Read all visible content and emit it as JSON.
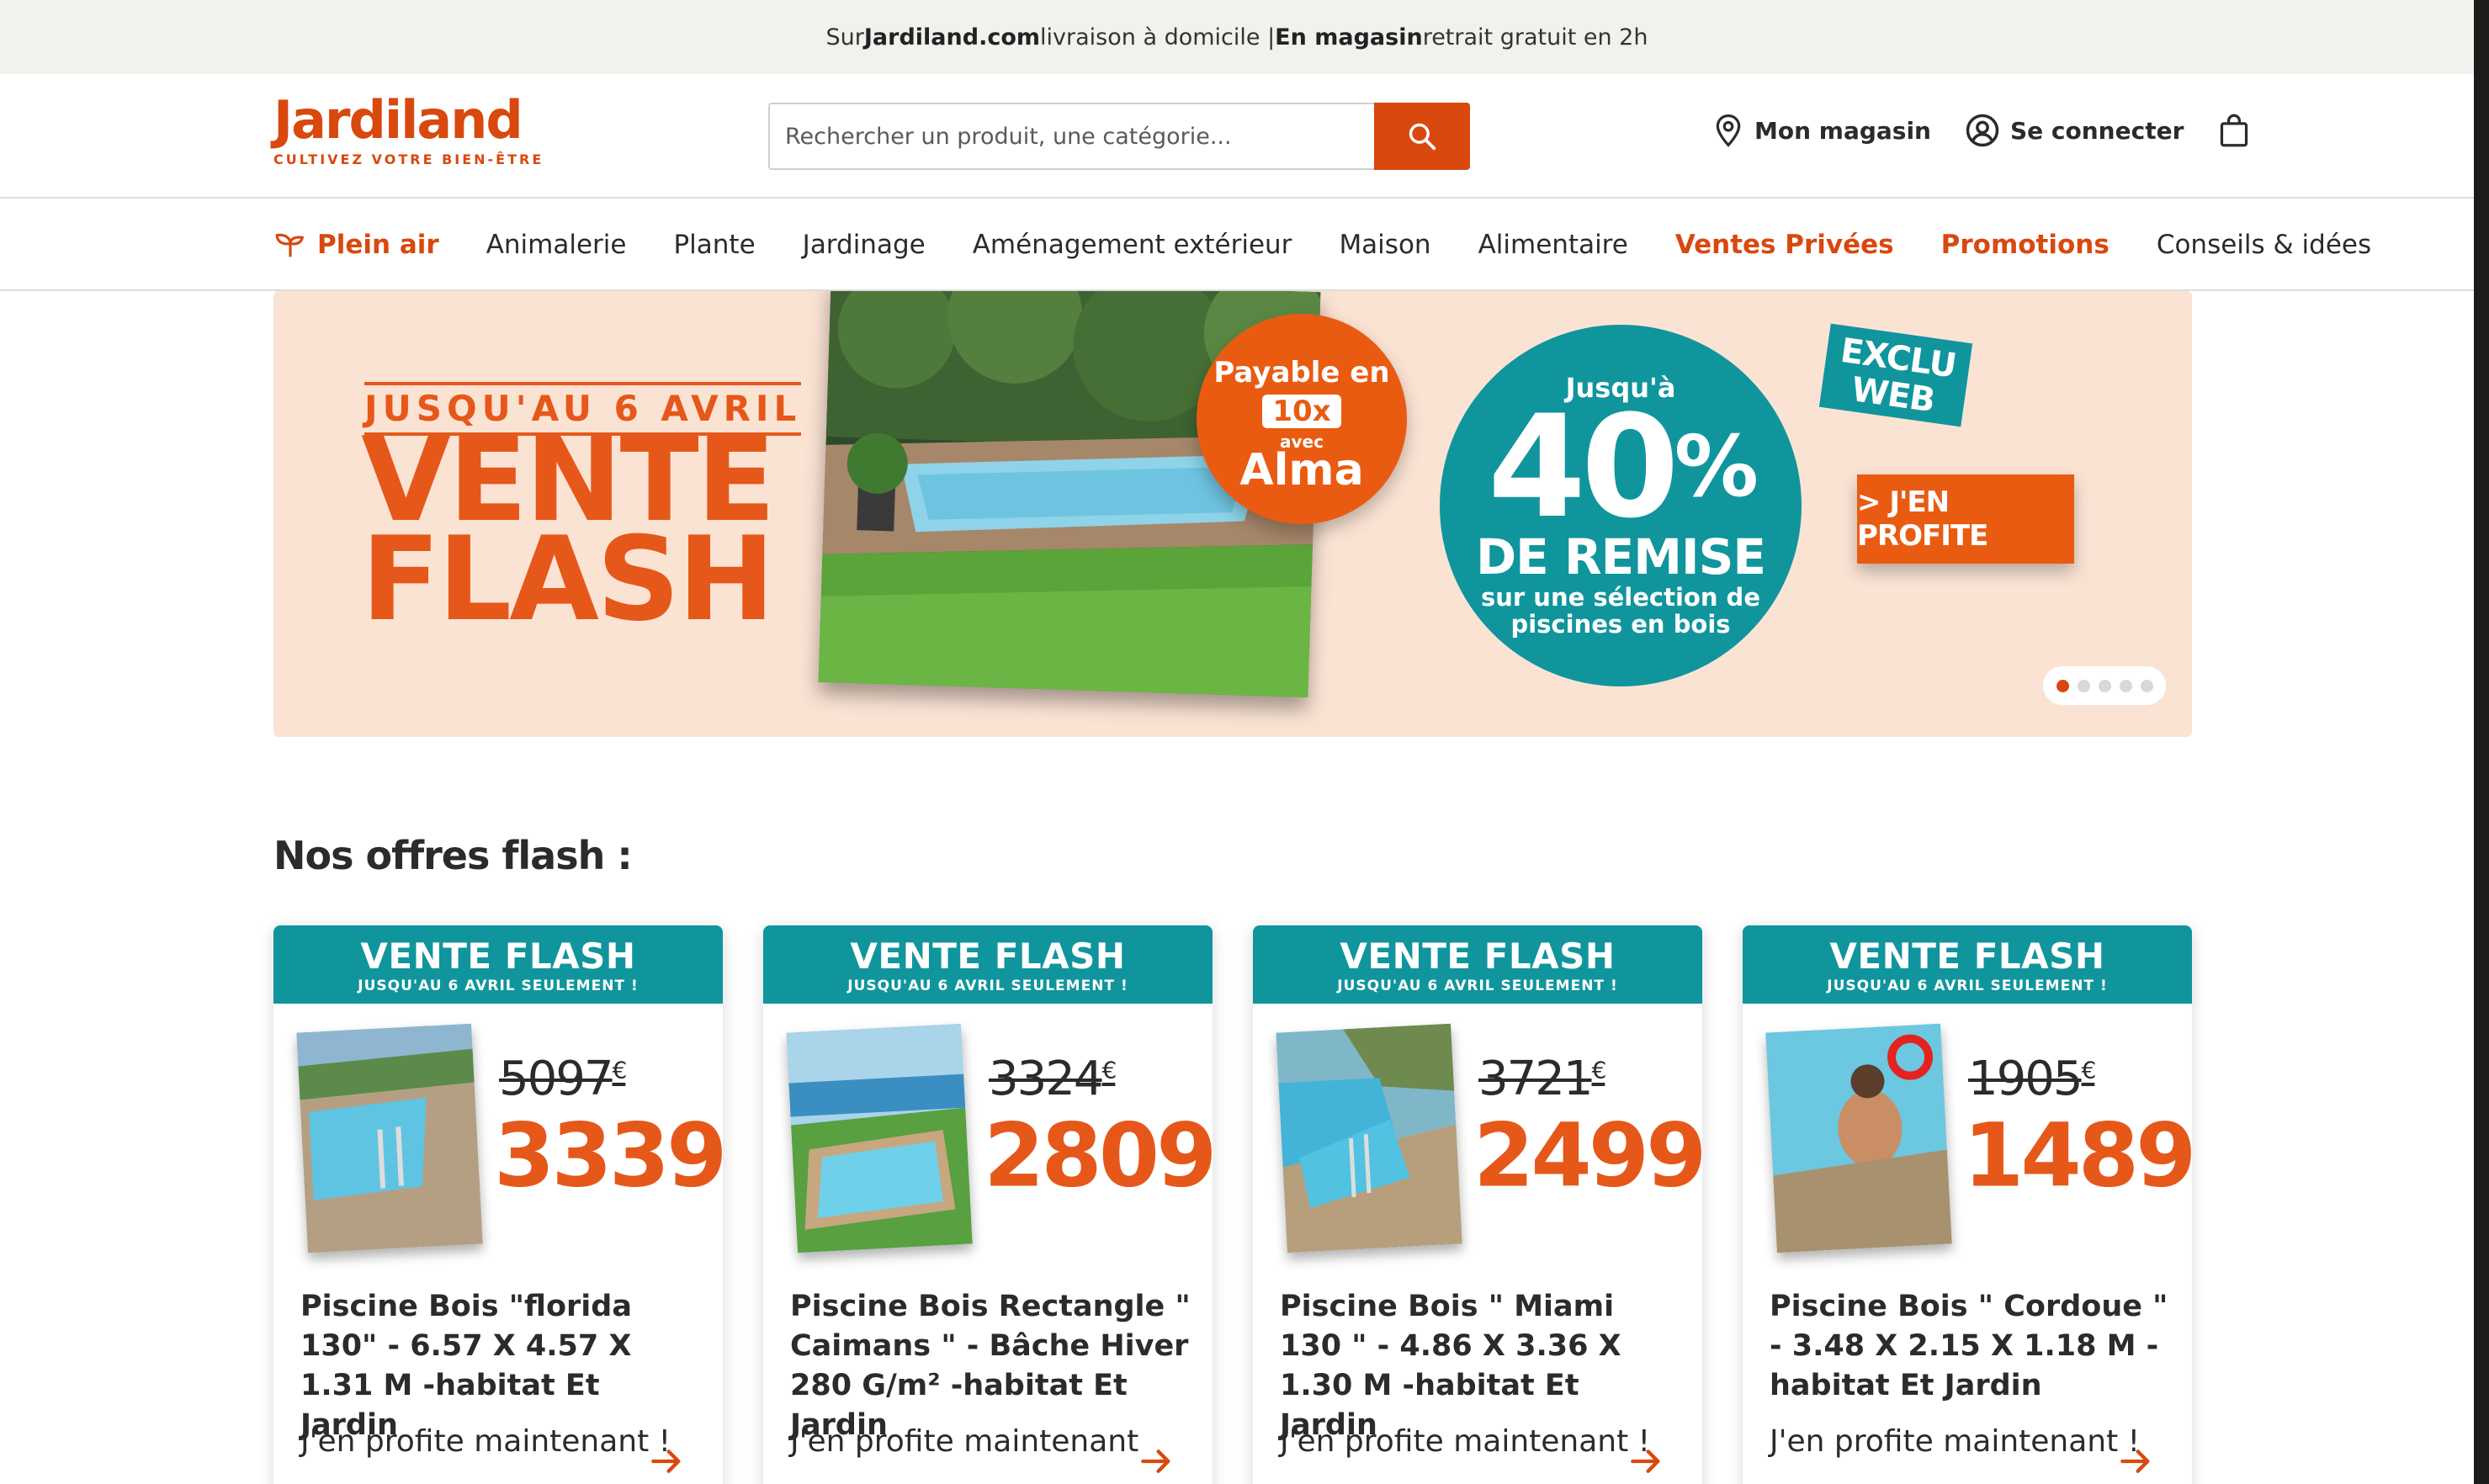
{
  "topbar": {
    "pre": "Sur ",
    "site": "Jardiland.com",
    "mid": " livraison à domicile | ",
    "store": "En magasin",
    "post": " retrait gratuit en 2h"
  },
  "header": {
    "logo_name": "Jardiland",
    "logo_tagline": "CULTIVEZ VOTRE BIEN-ÊTRE",
    "search_placeholder": "Rechercher un produit, une catégorie...",
    "store_label": "Mon magasin",
    "login_label": "Se connecter"
  },
  "nav": {
    "items": [
      {
        "label": "Plein air",
        "accent": true
      },
      {
        "label": "Animalerie",
        "accent": false
      },
      {
        "label": "Plante",
        "accent": false
      },
      {
        "label": "Jardinage",
        "accent": false
      },
      {
        "label": "Aménagement extérieur",
        "accent": false
      },
      {
        "label": "Maison",
        "accent": false
      },
      {
        "label": "Alimentaire",
        "accent": false
      },
      {
        "label": "Ventes Privées",
        "accent": true
      },
      {
        "label": "Promotions",
        "accent": true
      },
      {
        "label": "Conseils & idées",
        "accent": false
      }
    ]
  },
  "hero": {
    "date": "JUSQU'AU 6 AVRIL",
    "title_line1": "VENTE",
    "title_line2": "FLASH",
    "alma_line1": "Payable en",
    "alma_line2": "10x",
    "alma_line3": "avec",
    "alma_line4": "Alma",
    "promo_line1": "Jusqu'à",
    "promo_number": "40",
    "promo_percent": "%",
    "promo_line3": "DE REMISE",
    "promo_line4": "sur une sélection de",
    "promo_line5": "piscines en bois",
    "exclu_line1": "EXCLU",
    "exclu_line2": "WEB",
    "cta_label": "> J'EN PROFITE",
    "slide_count": 5,
    "active_slide": 1
  },
  "section_title": "Nos offres flash :",
  "cards": [
    {
      "band_title": "VENTE FLASH",
      "band_sub": "JUSQU'AU 6 AVRIL SEULEMENT !",
      "old_price": "5097",
      "new_price": "3339",
      "currency": "€",
      "title": "Piscine Bois \"florida 130\" - 6.57 X 4.57 X 1.31 M -habitat Et Jardin",
      "link": "J'en profite maintenant !"
    },
    {
      "band_title": "VENTE FLASH",
      "band_sub": "JUSQU'AU 6 AVRIL SEULEMENT !",
      "old_price": "3324",
      "new_price": "2809",
      "currency": "€",
      "title": "Piscine Bois Rectangle \" Caimans \" - Bâche Hiver 280 G/m² -habitat Et Jardin",
      "link": "J'en profite maintenant"
    },
    {
      "band_title": "VENTE FLASH",
      "band_sub": "JUSQU'AU 6 AVRIL SEULEMENT !",
      "old_price": "3721",
      "new_price": "2499",
      "currency": "€",
      "title": "Piscine Bois \" Miami 130 \" - 4.86 X 3.36 X 1.30 M -habitat Et Jardin",
      "link": "J'en profite maintenant !"
    },
    {
      "band_title": "VENTE FLASH",
      "band_sub": "JUSQU'AU 6 AVRIL SEULEMENT !",
      "old_price": "1905",
      "new_price": "1489",
      "currency": "€",
      "title": "Piscine Bois \" Cordoue \" - 3.48 X 2.15 X 1.18 M -habitat Et Jardin",
      "link": "J'en profite maintenant !"
    }
  ],
  "colors": {
    "brand_orange": "#d9480f",
    "teal": "#10959d",
    "hero_bg": "#fbe3d4"
  }
}
